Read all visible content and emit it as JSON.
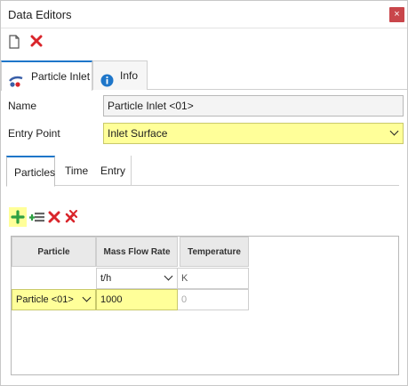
{
  "window": {
    "title": "Data Editors",
    "close_glyph": "×"
  },
  "toolbar": {
    "new_icon": "new-document-icon",
    "delete_icon": "delete-x-icon"
  },
  "main_tabs": [
    {
      "label": "Particle Inlet",
      "icon": "particle-inlet-icon",
      "active": true
    },
    {
      "label": "Info",
      "icon": "info-icon",
      "active": false
    }
  ],
  "form": {
    "name_label": "Name",
    "name_value": "Particle Inlet <01>",
    "entry_label": "Entry Point",
    "entry_value": "Inlet Surface"
  },
  "sub_tabs": [
    {
      "label": "Particles",
      "active": true
    },
    {
      "label": "Time",
      "active": false
    },
    {
      "label": "Entry",
      "active": false
    }
  ],
  "grid_toolbar": [
    "add-icon",
    "add-list-icon",
    "delete-icon",
    "delete-all-icon"
  ],
  "table": {
    "headers": [
      "Particle",
      "Mass Flow Rate",
      "Temperature"
    ],
    "units": [
      "",
      "t/h",
      "K"
    ],
    "rows": [
      {
        "particle": "Particle <01>",
        "mass_flow": "1000",
        "temperature": "0"
      }
    ]
  },
  "colors": {
    "highlight": "#ffff99",
    "accent": "#1e76c9",
    "delete_red": "#d9252b",
    "add_green": "#2ea043"
  }
}
